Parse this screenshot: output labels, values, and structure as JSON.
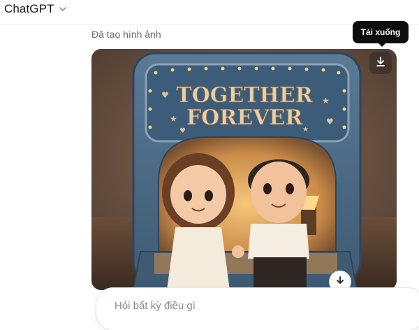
{
  "header": {
    "model_name": "ChatGPT",
    "model_icon": "chevron-down-icon"
  },
  "message": {
    "status_label": "Đã tạo hình ảnh",
    "image": {
      "sign_line1": "TOGETHER",
      "sign_line2": "FOREVER"
    }
  },
  "image_actions": {
    "download_tooltip": "Tải xuống",
    "download_icon": "download-icon"
  },
  "scroll": {
    "icon": "arrow-down-icon"
  },
  "composer": {
    "placeholder": "Hỏi bất kỳ điều gì",
    "value": ""
  },
  "colors": {
    "accent_dark": "#0d0d0d",
    "frame_blue": "#4c6a86",
    "sign_text": "#e7cfa8"
  }
}
